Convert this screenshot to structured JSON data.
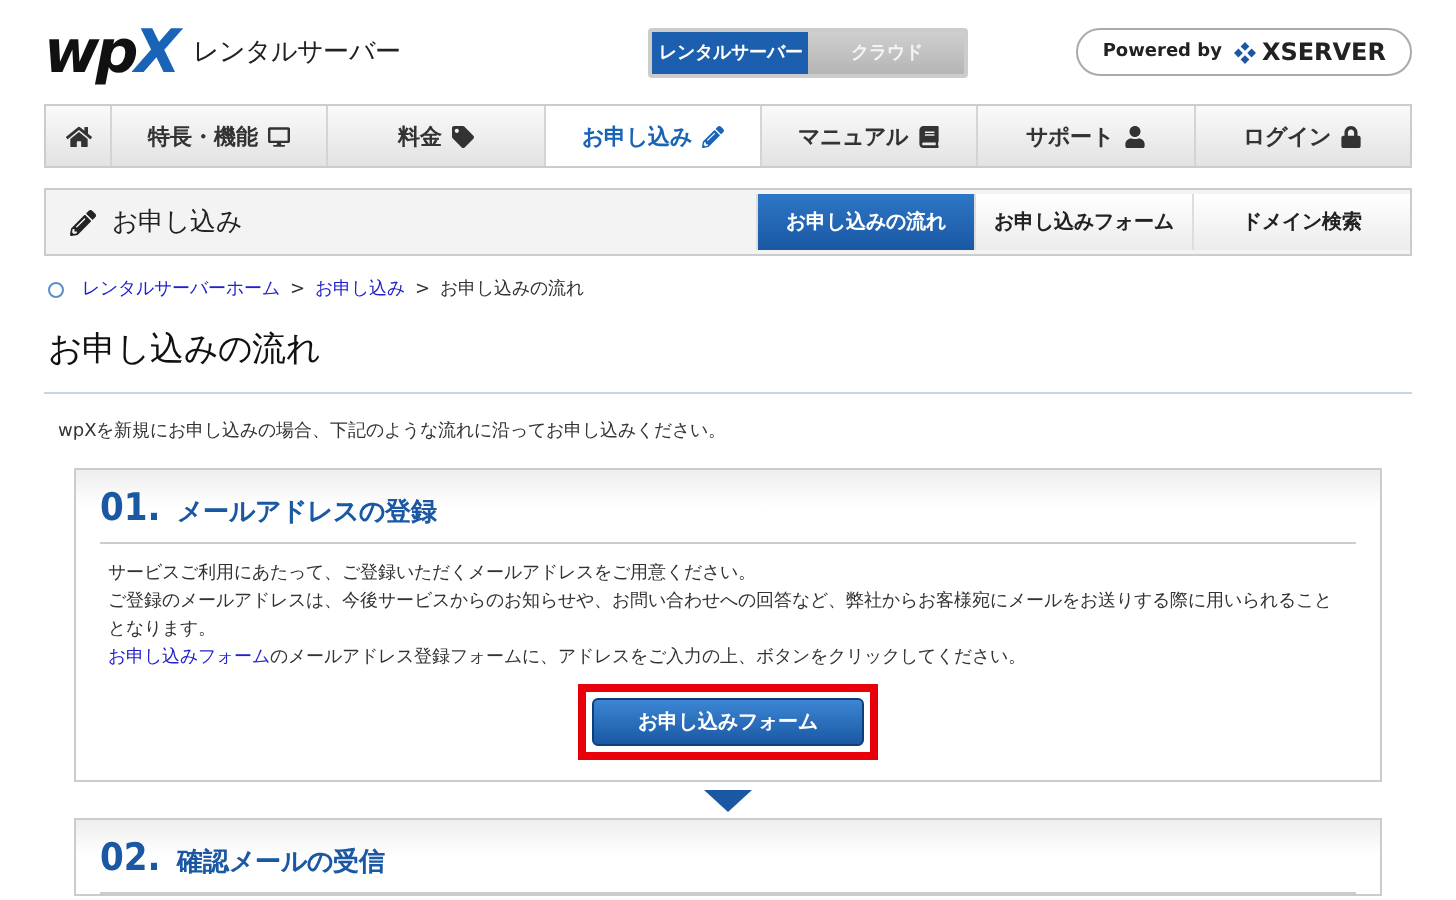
{
  "header": {
    "logo": {
      "mark": "wp",
      "accent": "X",
      "subtitle": "レンタルサーバー"
    },
    "product_tabs": [
      {
        "label": "レンタルサーバー",
        "selected": true
      },
      {
        "label": "クラウド",
        "selected": false
      }
    ],
    "powered_by": {
      "label": "Powered by",
      "brand": "XSERVER"
    }
  },
  "nav": {
    "items": [
      {
        "selected": false
      },
      {
        "label": "特長・機能",
        "selected": false
      },
      {
        "label": "料金",
        "selected": false
      },
      {
        "label": "お申し込み",
        "selected": true
      },
      {
        "label": "マニュアル",
        "selected": false
      },
      {
        "label": "サポート",
        "selected": false
      },
      {
        "label": "ログイン",
        "selected": false
      }
    ]
  },
  "subnav": {
    "title": "お申し込み",
    "tabs": [
      {
        "label": "お申し込みの流れ",
        "selected": true
      },
      {
        "label": "お申し込みフォーム",
        "selected": false
      },
      {
        "label": "ドメイン検索",
        "selected": false
      }
    ]
  },
  "breadcrumb": [
    {
      "label": "レンタルサーバーホーム",
      "kind": "link"
    },
    {
      "label": ">",
      "kind": "separator"
    },
    {
      "label": "お申し込み",
      "kind": "link"
    },
    {
      "label": ">",
      "kind": "separator"
    },
    {
      "label": "お申し込みの流れ",
      "kind": "current"
    }
  ],
  "page_title": "お申し込みの流れ",
  "intro": "wpXを新規にお申し込みの場合、下記のような流れに沿ってお申し込みください。",
  "steps": [
    {
      "number": "01.",
      "title": "メールアドレスの登録",
      "paragraphs": [
        {
          "text": "サービスご利用にあたって、ご登録いただくメールアドレスをご用意ください。"
        },
        {
          "text": "ご登録のメールアドレスは、今後サービスからのお知らせや、お問い合わせへの回答など、弊社からお客様宛にメールをお送りする際に用いられることとなります。"
        },
        {
          "link": "お申し込みフォーム",
          "text": "のメールアドレス登録フォームに、アドレスをご入力の上、ボタンをクリックしてください。"
        }
      ],
      "button": {
        "label": "お申し込みフォーム",
        "highlighted": true
      }
    },
    {
      "number": "02.",
      "title": "確認メールの受信"
    }
  ]
}
